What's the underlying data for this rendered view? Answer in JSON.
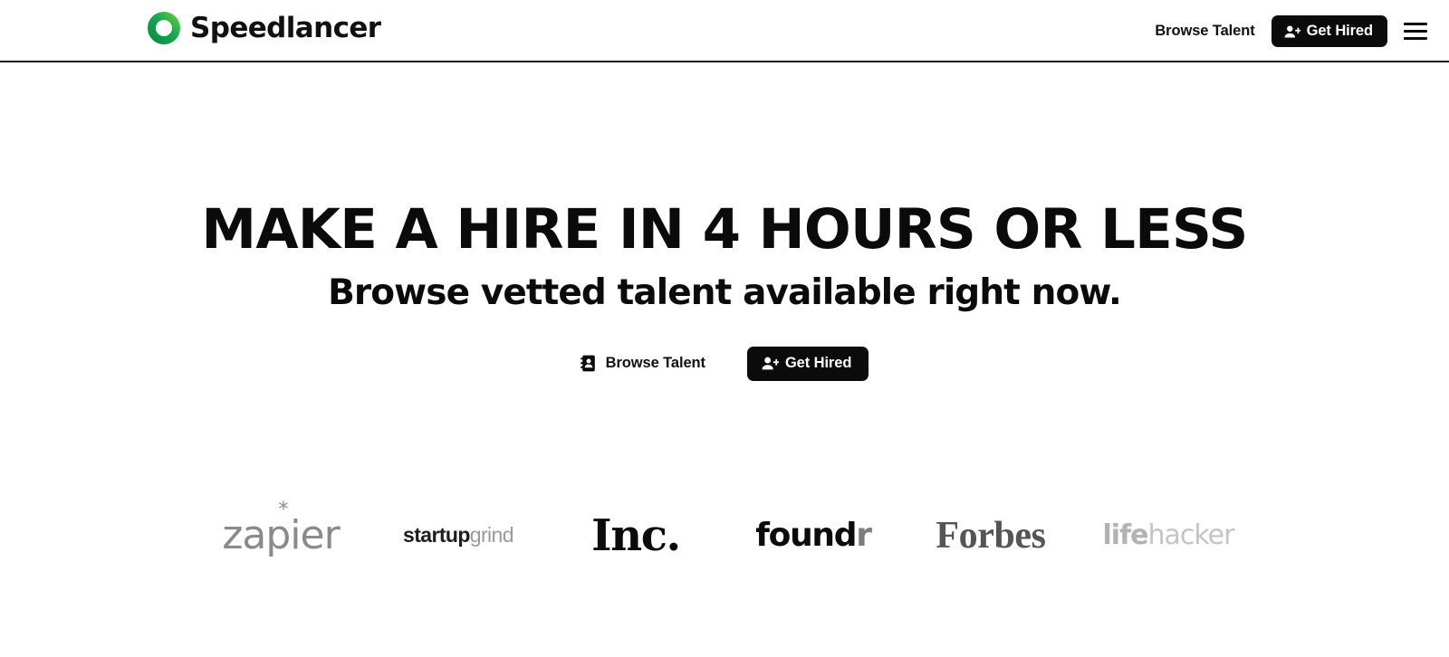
{
  "brand": {
    "name": "Speedlancer",
    "mark_icon": "green-ring-logo-icon",
    "colors": {
      "ring_dark": "#0f9b4c",
      "ring_light": "#4cc63f",
      "ink": "#0b0b0b"
    }
  },
  "header": {
    "nav_link_label": "Browse Talent",
    "cta_label": "Get Hired",
    "cta_icon": "user-plus-icon",
    "menu_icon": "hamburger-menu-icon"
  },
  "hero": {
    "title": "MAKE A HIRE IN 4 HOURS OR LESS",
    "subtitle": "Browse vetted talent available right now.",
    "browse_label": "Browse Talent",
    "browse_icon": "address-book-icon",
    "cta_label": "Get Hired",
    "cta_icon": "user-plus-icon"
  },
  "press": {
    "items": [
      {
        "name": "zapier",
        "text": "zapier",
        "star": "*"
      },
      {
        "name": "startupgrind",
        "bold": "startup",
        "light": "grind"
      },
      {
        "name": "inc",
        "text": "Inc."
      },
      {
        "name": "foundr",
        "dark": "found",
        "light": "r"
      },
      {
        "name": "forbes",
        "text": "Forbes"
      },
      {
        "name": "lifehacker",
        "bold": "life",
        "light": "hacker"
      }
    ]
  }
}
